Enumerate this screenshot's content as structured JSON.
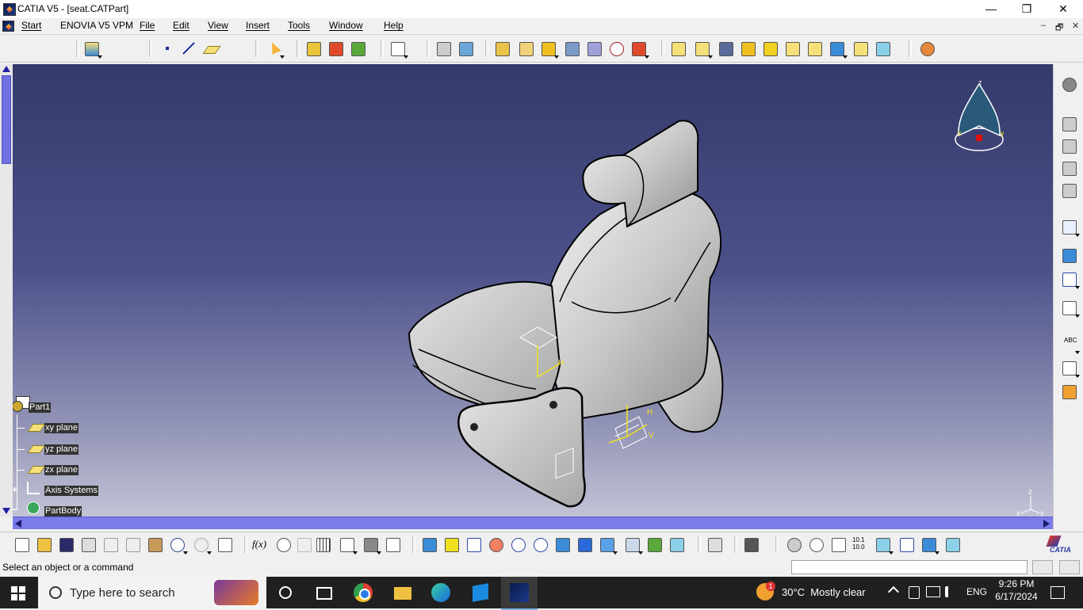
{
  "window": {
    "title": "CATIA V5 - [seat.CATPart]",
    "controls": {
      "minimize": "—",
      "restore": "❐",
      "close": "✕"
    },
    "mdi_controls": {
      "minimize": "–",
      "restore": "🗗",
      "close": "✕"
    }
  },
  "menubar": {
    "items": [
      "Start",
      "ENOVIA V5 VPM",
      "File",
      "Edit",
      "View",
      "Insert",
      "Tools",
      "Window",
      "Help"
    ]
  },
  "tree": {
    "root": "Part1",
    "children": [
      "xy plane",
      "yz plane",
      "zx plane",
      "Axis Systems",
      "PartBody"
    ],
    "expanders": {
      "axis": "+",
      "body": "−"
    }
  },
  "viewport": {
    "compass_labels": {
      "z": "z",
      "x": "x",
      "y": "y"
    },
    "axis_labels": {
      "z": "z",
      "x": "x",
      "y": "y"
    },
    "sketch_labels": {
      "v": "V",
      "h": "H"
    }
  },
  "status": {
    "message": "Select an object or a command"
  },
  "taskbar": {
    "search_placeholder": "Type here to search",
    "weather": "30°C  Mostly clear",
    "weather_badge": "1",
    "language": "ENG",
    "time": "9:26 PM",
    "date": "6/17/2024"
  },
  "toolbar_bottom": {
    "fx_label": "f(x)",
    "grid_label": "10.1\n10.0",
    "abc_label": "ABC"
  },
  "brand": {
    "logo_text": "CATIA"
  },
  "colors": {
    "viewport_top": "#353a6b",
    "viewport_bottom": "#c3c3d6",
    "scrollbar": "#7b7bea",
    "taskbar": "#202020"
  }
}
